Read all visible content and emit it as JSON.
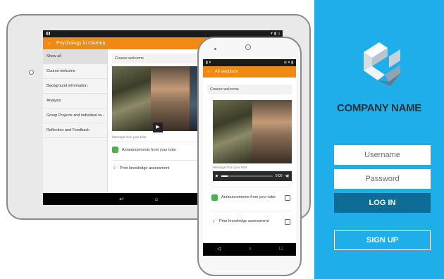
{
  "tablet": {
    "app_title": "Psychology in Cinema",
    "sidebar": {
      "items": [
        {
          "label": "Show all"
        },
        {
          "label": "Course welcome"
        },
        {
          "label": "Background information"
        },
        {
          "label": "Analysis"
        },
        {
          "label": "Group Projects and individual ta..."
        },
        {
          "label": "Reflection and Feedback"
        }
      ]
    },
    "card_title": "Course welcome",
    "message_label": "Message from your tutor",
    "rows": [
      {
        "label": "Announcements from your tutor"
      },
      {
        "label": "Prior knowledge assessment"
      }
    ]
  },
  "phone": {
    "app_title": "All sections",
    "card_title": "Course welcome",
    "message_label": "Message from your tutor",
    "player": {
      "time": "0:00",
      "progress": 0.12
    },
    "rows": [
      {
        "label": "Announcements from your tutor"
      },
      {
        "label": "Prior knowledge assessment"
      }
    ]
  },
  "login": {
    "company_name": "COMPANY NAME",
    "username_placeholder": "Username",
    "password_placeholder": "Password",
    "login_label": "LOG IN",
    "signup_label": "SIGN UP"
  },
  "colors": {
    "panel": "#1eaee9",
    "login_button": "#0d6d96",
    "app_bar": "#f08a12",
    "company_text": "#263238"
  },
  "icons": [
    "back-arrow-icon",
    "play-icon",
    "volume-icon",
    "announcement-icon",
    "lightbulb-icon",
    "back-nav-icon",
    "home-nav-icon",
    "recents-nav-icon",
    "company-logo"
  ]
}
